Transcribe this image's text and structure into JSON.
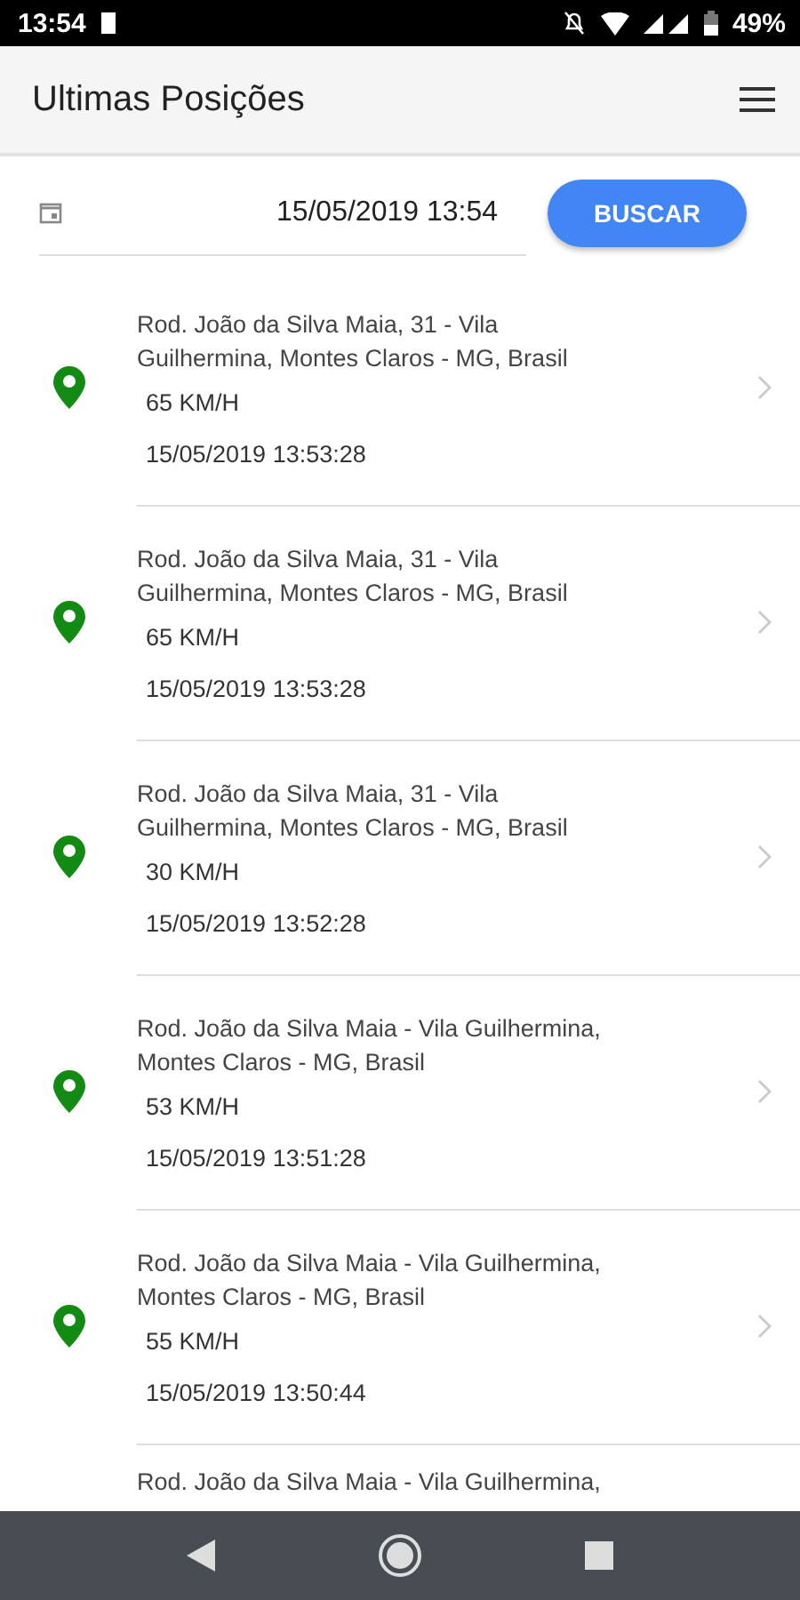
{
  "status_bar": {
    "time": "13:54",
    "battery": "49%"
  },
  "app_bar": {
    "title": "Ultimas Posições"
  },
  "search": {
    "date": "15/05/2019 13:54",
    "button": "BUSCAR"
  },
  "positions": [
    {
      "address": "Rod. João da Silva Maia, 31 - Vila Guilhermina, Montes Claros - MG, Brasil",
      "speed": "65 KM/H",
      "time": "15/05/2019 13:53:28"
    },
    {
      "address": "Rod. João da Silva Maia, 31 - Vila Guilhermina, Montes Claros - MG, Brasil",
      "speed": "65 KM/H",
      "time": "15/05/2019 13:53:28"
    },
    {
      "address": "Rod. João da Silva Maia, 31 - Vila Guilhermina, Montes Claros - MG, Brasil",
      "speed": "30 KM/H",
      "time": "15/05/2019 13:52:28"
    },
    {
      "address": "Rod. João da Silva Maia - Vila Guilhermina, Montes Claros - MG, Brasil",
      "speed": "53 KM/H",
      "time": "15/05/2019 13:51:28"
    },
    {
      "address": "Rod. João da Silva Maia - Vila Guilhermina, Montes Claros - MG, Brasil",
      "speed": "55 KM/H",
      "time": "15/05/2019 13:50:44"
    },
    {
      "address": "Rod. João da Silva Maia - Vila Guilhermina,"
    }
  ]
}
